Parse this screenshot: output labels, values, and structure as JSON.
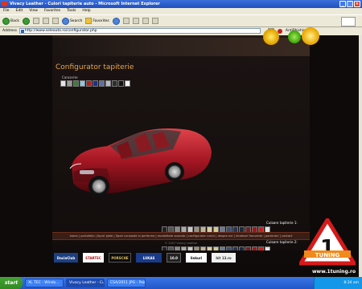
{
  "window": {
    "title": "Vivacy Leather - Culori tapiterie auto - Microsoft Internet Explorer",
    "controls": {
      "minimize": "_",
      "maximize": "□",
      "close": "×"
    }
  },
  "menu": [
    "File",
    "Edit",
    "View",
    "Favorites",
    "Tools",
    "Help"
  ],
  "toolbar": {
    "back_label": "Back",
    "search_label": "Search",
    "favorites_label": "Favorites",
    "antiphishing_label": "AntiPhishing"
  },
  "address": {
    "label": "Address",
    "url": "http://www.seleauto.ro/configurator.php"
  },
  "page": {
    "title": "Configurator tapiterie",
    "caroserie_label": "Caroserie:",
    "tap1_label": "Culoare tapiterie 1:",
    "tap2_label": "Culoare tapiterie 2:",
    "body_colors": [
      "#e6e6e6",
      "#9a9a9a",
      "#3f7a3c",
      "#8bc7e0",
      "#b51d1d",
      "#1e2f8c",
      "#5d6fa3",
      "#b9b9c7",
      "#2d2d2d",
      "#121212",
      "#f2f2f2"
    ],
    "tap1_colors": [
      "#222",
      "#555",
      "#888",
      "#a9a9a9",
      "#c8c8c8",
      "#9a8e78",
      "#c2b391",
      "#d8cda6",
      "#d4c98e",
      "#6b7a8f",
      "#3a4d73",
      "#2a3550",
      "#1d2a3b",
      "#6f1f1f",
      "#a01818",
      "#c82020",
      "#e2e2e2"
    ],
    "tap2_colors": [
      "#222",
      "#555",
      "#888",
      "#a9a9a9",
      "#c8c8c8",
      "#9a8e78",
      "#c2b391",
      "#d8cda6",
      "#d4c98e",
      "#6b7a8f",
      "#3a4d73",
      "#2a3550",
      "#1d2a3b",
      "#6f1f1f",
      "#a01818",
      "#c82020",
      "#e2e2e2"
    ],
    "footer_nav": "home | portofolio | tipuri piele | Spori cunoaste si performe | modalitate scoaute | configurator culori | despre noi | intrebari frecvente | parteneri | contact",
    "copyright": "© 2007 Vivacy Leather"
  },
  "partners": [
    "DaciaClub",
    "STARTEC",
    "PORSCHE",
    "LUKAS",
    "10.0",
    "linkuri",
    "hit 13.ro"
  ],
  "watermark": {
    "url": "www.1tuning.ro",
    "logo_text": "TUNING",
    "logo_number": "1"
  },
  "taskbar": {
    "start": "start",
    "tasks": [
      "XL TEC - Windo...",
      "Vivacy Leather - Cult...",
      "CSA/2011 JPG - Paint"
    ],
    "clock": "8:34 am"
  }
}
